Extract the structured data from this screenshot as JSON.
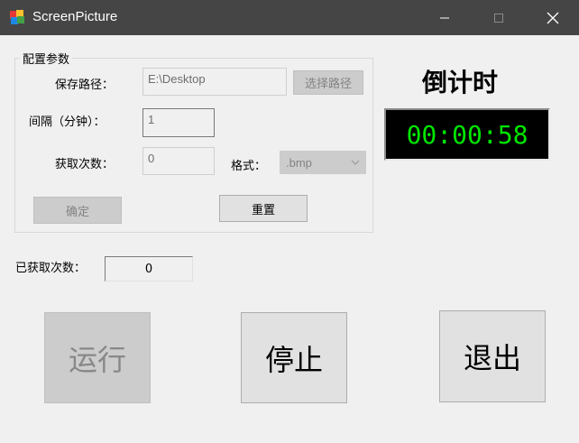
{
  "window": {
    "title": "ScreenPicture"
  },
  "config": {
    "group_title": "配置参数",
    "save_path_label": "保存路径：",
    "save_path_value": "E:\\Desktop",
    "choose_path_button": "选择路径",
    "interval_label": "间隔（分钟）：",
    "interval_value": "1",
    "capture_count_label": "获取次数：",
    "capture_count_value": "0",
    "format_label": "格式：",
    "format_value": ".bmp",
    "confirm_button": "确定",
    "reset_button": "重置"
  },
  "countdown": {
    "title": "倒计时",
    "time": "00:00:58",
    "time_color": "#00e600"
  },
  "captured": {
    "label": "已获取次数：",
    "value": "0"
  },
  "actions": {
    "run": "运行",
    "stop": "停止",
    "exit": "退出"
  }
}
